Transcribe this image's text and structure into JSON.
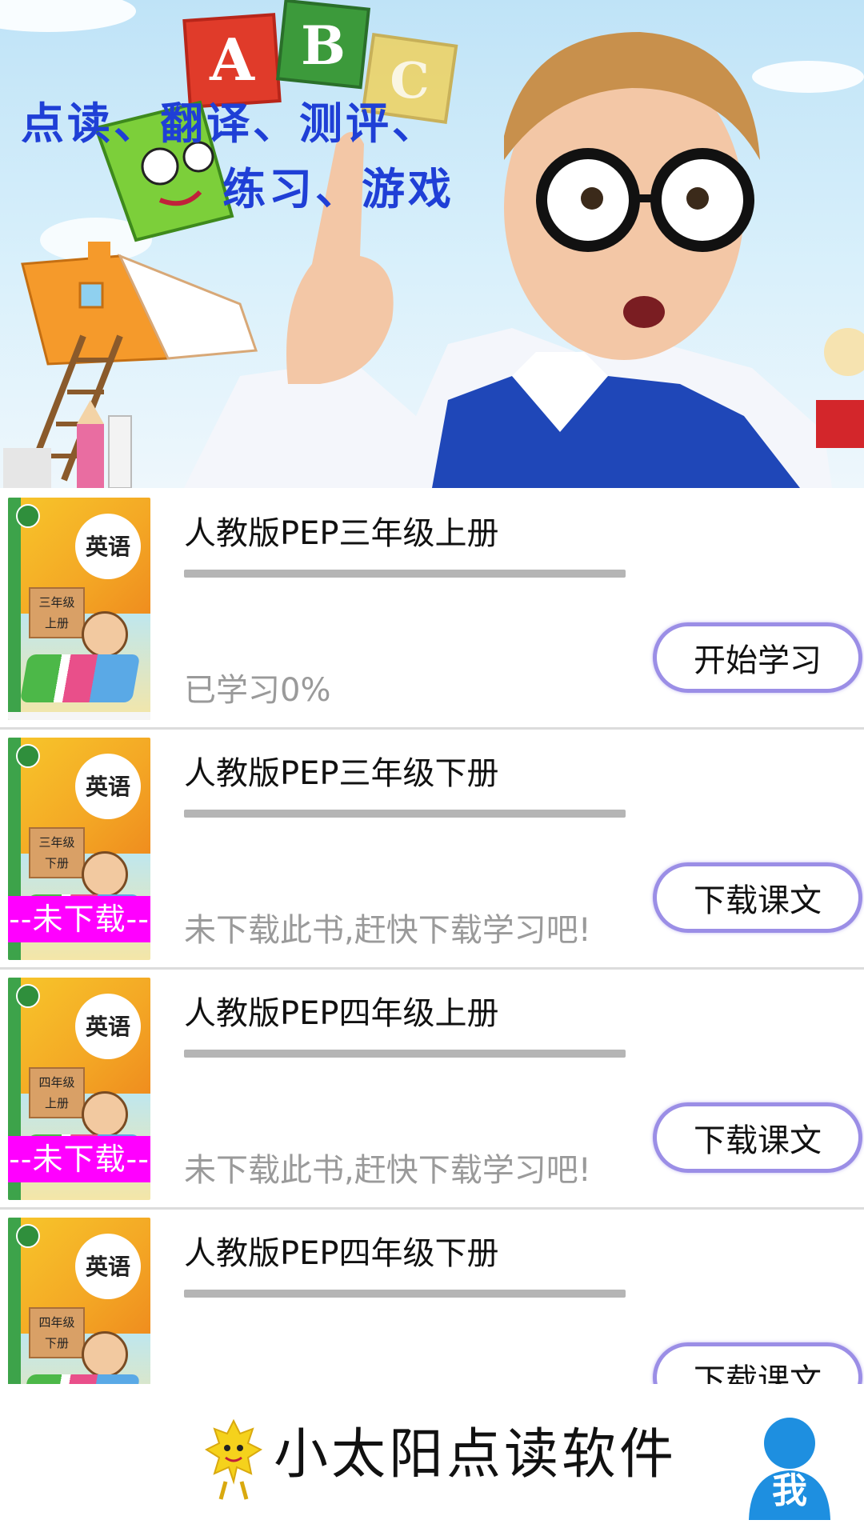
{
  "banner": {
    "blocks": [
      "A",
      "B",
      "C"
    ],
    "slogan_line1": "点读、翻译、测评、",
    "slogan_line2": "练习、游戏"
  },
  "books": [
    {
      "title": "人教版PEP三年级上册",
      "cover_title": "英语",
      "cover_grade": "三年级",
      "cover_volume": "上册",
      "status": "已学习0%",
      "progress": 0,
      "downloaded": true,
      "tag": "",
      "button": "开始学习"
    },
    {
      "title": "人教版PEP三年级下册",
      "cover_title": "英语",
      "cover_grade": "三年级",
      "cover_volume": "下册",
      "status": "未下载此书,赶快下载学习吧!",
      "progress": 0,
      "downloaded": false,
      "tag": "--未下载--",
      "button": "下载课文"
    },
    {
      "title": "人教版PEP四年级上册",
      "cover_title": "英语",
      "cover_grade": "四年级",
      "cover_volume": "上册",
      "status": "未下载此书,赶快下载学习吧!",
      "progress": 0,
      "downloaded": false,
      "tag": "--未下载--",
      "button": "下载课文"
    },
    {
      "title": "人教版PEP四年级下册",
      "cover_title": "英语",
      "cover_grade": "四年级",
      "cover_volume": "下册",
      "status": "",
      "progress": 0,
      "downloaded": false,
      "tag": "",
      "button": "下载课文"
    }
  ],
  "bottom_bar": {
    "mascot_icon": "sun-mascot-icon",
    "brand_name": "小太阳点读软件",
    "profile_icon": "user-icon",
    "profile_label": "我"
  },
  "colors": {
    "slogan": "#1f3fd6",
    "button_border": "#9b8ee6",
    "progress_track": "#b5b5b5",
    "status_text": "#9a9a9a",
    "undownloaded_tag": "#ff00ff",
    "profile_icon": "#1e8fe0",
    "mascot": "#f5d21c"
  }
}
